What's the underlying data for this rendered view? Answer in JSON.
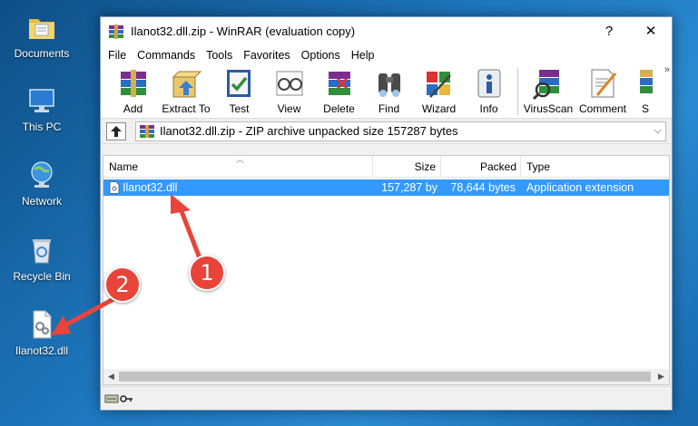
{
  "desktop": {
    "icons": [
      {
        "label": "Documents",
        "icon": "folder-icon"
      },
      {
        "label": "This PC",
        "icon": "computer-icon"
      },
      {
        "label": "Network",
        "icon": "network-icon"
      },
      {
        "label": "Recycle Bin",
        "icon": "recycle-bin-icon"
      },
      {
        "label": "Ilanot32.dll",
        "icon": "dll-file-icon"
      }
    ]
  },
  "window": {
    "title": "Ilanot32.dll.zip - WinRAR (evaluation copy)",
    "help_btn": "?",
    "close_btn": "✕"
  },
  "menu": [
    "File",
    "Commands",
    "Tools",
    "Favorites",
    "Options",
    "Help"
  ],
  "toolbar": {
    "buttons": [
      {
        "label": "Add",
        "icon": "add-archive-icon"
      },
      {
        "label": "Extract To",
        "icon": "extract-icon"
      },
      {
        "label": "Test",
        "icon": "test-icon"
      },
      {
        "label": "View",
        "icon": "view-icon"
      },
      {
        "label": "Delete",
        "icon": "delete-icon"
      },
      {
        "label": "Find",
        "icon": "find-icon"
      },
      {
        "label": "Wizard",
        "icon": "wizard-icon"
      },
      {
        "label": "Info",
        "icon": "info-icon"
      },
      {
        "label": "VirusScan",
        "icon": "virus-scan-icon"
      },
      {
        "label": "Comment",
        "icon": "comment-icon"
      },
      {
        "label": "S",
        "icon": "sfx-icon"
      }
    ],
    "more": "»"
  },
  "address": {
    "text": "Ilanot32.dll.zip - ZIP archive unpacked size 157287 bytes"
  },
  "filelist": {
    "columns": [
      "Name",
      "Size",
      "Packed",
      "Type"
    ],
    "rows": [
      {
        "name": "Ilanot32.dll",
        "size": "157,287 by",
        "packed": "78,644 bytes",
        "type": "Application extension"
      }
    ]
  },
  "annotations": {
    "step1": "1",
    "step2": "2",
    "arrow_color": "#e8443a"
  }
}
